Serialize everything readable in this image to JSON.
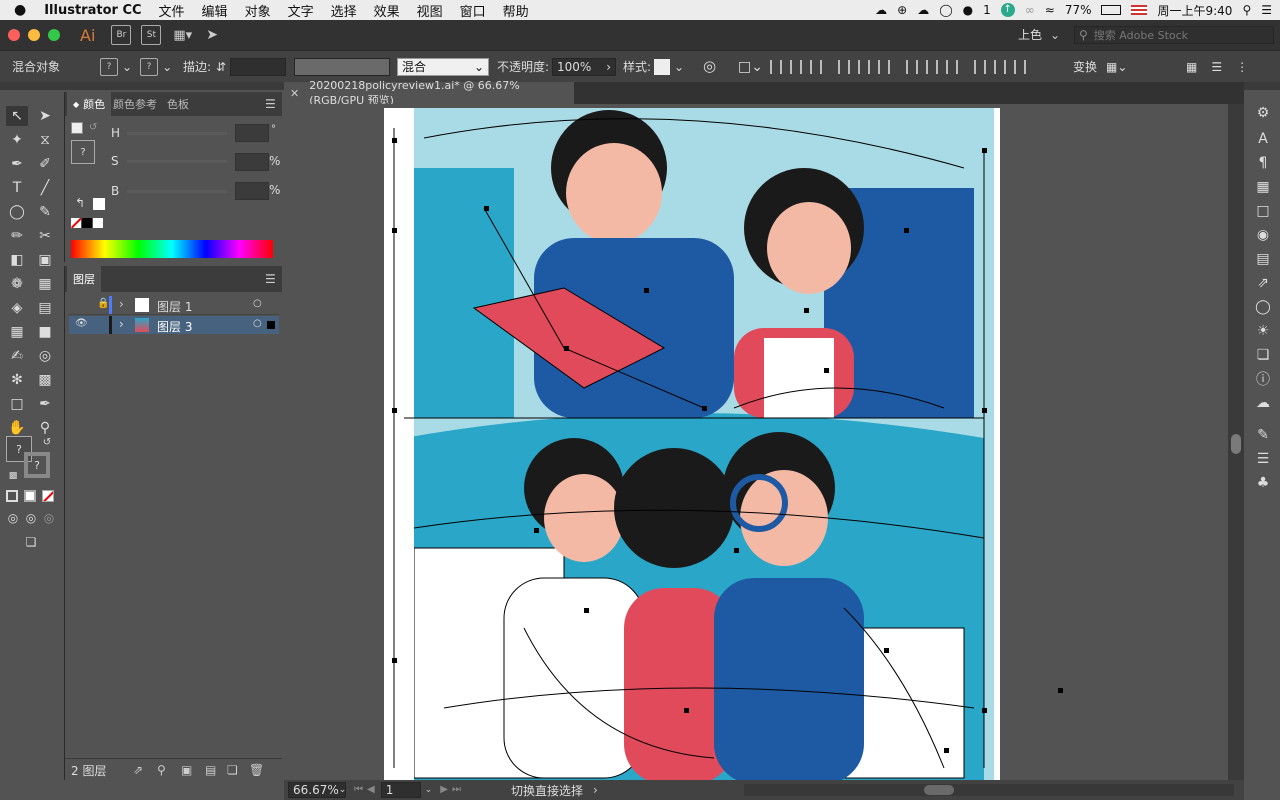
{
  "menubar": {
    "apple": "",
    "app_name": "Illustrator CC",
    "items": [
      "文件",
      "编辑",
      "对象",
      "文字",
      "选择",
      "效果",
      "视图",
      "窗口",
      "帮助"
    ],
    "notification_count": "1",
    "battery": "77%",
    "clock": "周一上午9:40"
  },
  "appbar": {
    "ai_logo": "Ai",
    "br": "Br",
    "st": "St",
    "workspace": "上色",
    "search_placeholder": "搜索 Adobe Stock"
  },
  "control": {
    "selection_label": "混合对象",
    "stroke_label": "描边:",
    "blend_mode": "混合",
    "opacity_label": "不透明度:",
    "opacity_value": "100%",
    "style_label": "样式:",
    "transform_label": "变换"
  },
  "color_panel": {
    "tabs": [
      "颜色",
      "颜色参考",
      "色板"
    ],
    "h_label": "H",
    "s_label": "S",
    "b_label": "B",
    "h_unit": "°",
    "s_unit": "%",
    "b_unit": "%"
  },
  "layers_panel": {
    "title": "图层",
    "layers": [
      {
        "name": "图层 1",
        "color": "#4f7cff"
      },
      {
        "name": "图层 3",
        "color": "#1a1a1a"
      }
    ],
    "footer_count": "2 图层"
  },
  "document": {
    "tab_title": "20200218policyreview1.ai* @ 66.67% (RGB/GPU 预览)"
  },
  "statusbar": {
    "zoom": "66.67%",
    "page": "1",
    "status_text": "切换直接选择"
  },
  "colors": {
    "artwork_blue": "#1e5aa3",
    "artwork_cyan": "#2aa6c8",
    "artwork_red": "#e04a5a",
    "artwork_skin": "#f4b9a5",
    "artwork_light": "#a9dbe6"
  }
}
